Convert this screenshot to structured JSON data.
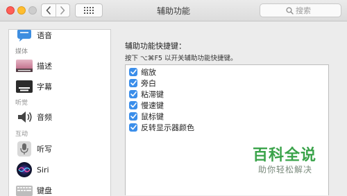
{
  "window": {
    "title": "辅助功能",
    "traffic_lights": {
      "close": "#ff5f57",
      "minimize": "#ffbd2e",
      "maximize": "#cdcdcd"
    }
  },
  "toolbar": {
    "back_icon": "chevron-left-icon",
    "forward_icon": "chevron-right-icon",
    "grid_icon": "show-all-grid-icon",
    "search_placeholder": "搜索"
  },
  "sidebar": {
    "item_voice": "语音",
    "group_media": "媒体",
    "item_description": "描述",
    "item_captions": "字幕",
    "group_hearing": "听觉",
    "item_audio": "音频",
    "group_interaction": "互动",
    "item_dictation": "听写",
    "item_siri": "Siri",
    "item_keyboard": "键盘"
  },
  "main": {
    "shortcut_title": "辅助功能快捷键：",
    "hint": "按下 ⌥⌘F5 以开关辅助功能快捷键。",
    "options": [
      {
        "label": "缩放",
        "checked": true
      },
      {
        "label": "旁白",
        "checked": true
      },
      {
        "label": "粘滞键",
        "checked": true
      },
      {
        "label": "慢速键",
        "checked": true
      },
      {
        "label": "鼠标键",
        "checked": true
      },
      {
        "label": "反转显示器颜色",
        "checked": true
      }
    ],
    "accent_color": "#3b8eea"
  },
  "watermark": {
    "main": "百科全说",
    "sub": "助你轻松解决",
    "color": "#3aa34a"
  }
}
